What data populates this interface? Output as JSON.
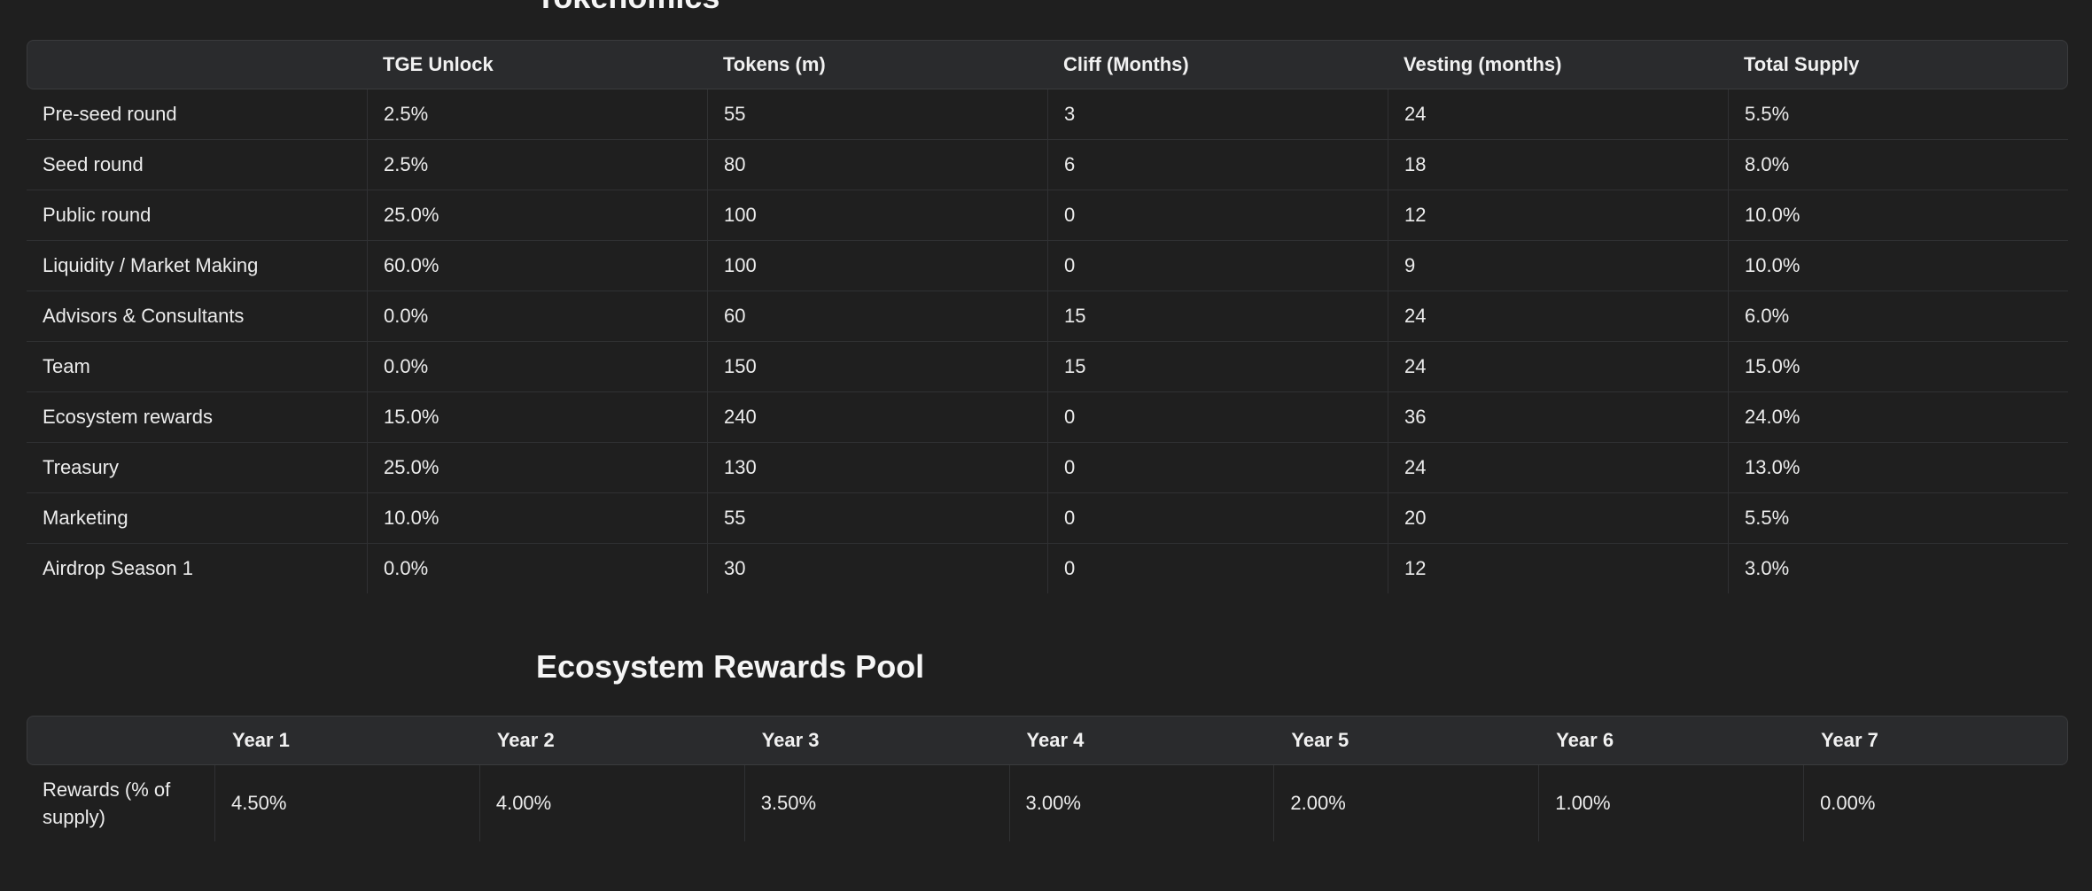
{
  "tokenomics": {
    "title": "Tokenomics",
    "columns": [
      "",
      "TGE Unlock",
      "Tokens (m)",
      "Cliff (Months)",
      "Vesting (months)",
      "Total Supply"
    ],
    "rows": [
      [
        "Pre-seed round",
        "2.5%",
        "55",
        "3",
        "24",
        "5.5%"
      ],
      [
        "Seed round",
        "2.5%",
        "80",
        "6",
        "18",
        "8.0%"
      ],
      [
        "Public round",
        "25.0%",
        "100",
        "0",
        "12",
        "10.0%"
      ],
      [
        "Liquidity / Market Making",
        "60.0%",
        "100",
        "0",
        "9",
        "10.0%"
      ],
      [
        "Advisors & Consultants",
        "0.0%",
        "60",
        "15",
        "24",
        "6.0%"
      ],
      [
        "Team",
        "0.0%",
        "150",
        "15",
        "24",
        "15.0%"
      ],
      [
        "Ecosystem rewards",
        "15.0%",
        "240",
        "0",
        "36",
        "24.0%"
      ],
      [
        "Treasury",
        "25.0%",
        "130",
        "0",
        "24",
        "13.0%"
      ],
      [
        "Marketing",
        "10.0%",
        "55",
        "0",
        "20",
        "5.5%"
      ],
      [
        "Airdrop Season 1",
        "0.0%",
        "30",
        "0",
        "12",
        "3.0%"
      ]
    ]
  },
  "ecosystem_rewards": {
    "title": "Ecosystem Rewards Pool",
    "columns": [
      "",
      "Year 1",
      "Year 2",
      "Year 3",
      "Year 4",
      "Year 5",
      "Year 6",
      "Year 7"
    ],
    "rows": [
      [
        "Rewards (% of supply)",
        "4.50%",
        "4.00%",
        "3.50%",
        "3.00%",
        "2.00%",
        "1.00%",
        "0.00%"
      ]
    ]
  }
}
